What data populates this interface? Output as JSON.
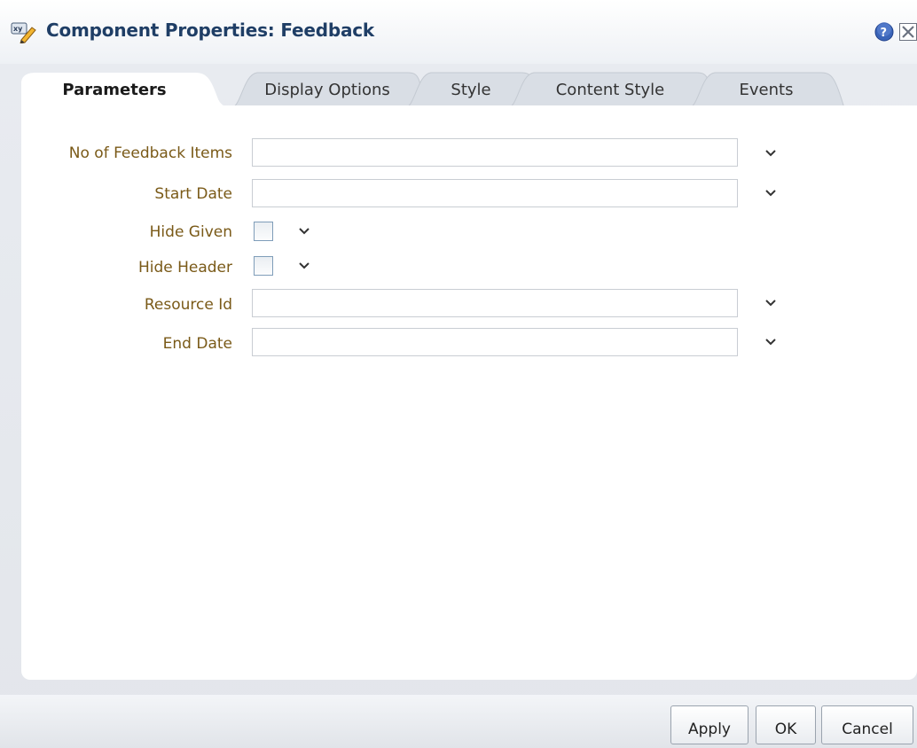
{
  "dialog": {
    "title": "Component Properties: Feedback",
    "icon": "xy-edit-icon",
    "help_icon": "help-icon",
    "close_icon": "close-icon"
  },
  "tabs": [
    {
      "label": "Parameters",
      "active": true
    },
    {
      "label": "Display Options",
      "active": false
    },
    {
      "label": "Style",
      "active": false
    },
    {
      "label": "Content Style",
      "active": false
    },
    {
      "label": "Events",
      "active": false
    }
  ],
  "form": {
    "fields": [
      {
        "label": "No of Feedback Items",
        "type": "text",
        "value": ""
      },
      {
        "label": "Start Date",
        "type": "text",
        "value": ""
      },
      {
        "label": "Hide Given",
        "type": "checkbox",
        "checked": false
      },
      {
        "label": "Hide Header",
        "type": "checkbox",
        "checked": false
      },
      {
        "label": "Resource Id",
        "type": "text",
        "value": ""
      },
      {
        "label": "End Date",
        "type": "text",
        "value": ""
      }
    ]
  },
  "buttons": {
    "apply": "Apply",
    "ok": "OK",
    "cancel": "Cancel"
  },
  "colors": {
    "title": "#1f3e66",
    "field_label": "#7a5a18",
    "tab_inactive": "#d8dde4",
    "panel": "#ffffff"
  }
}
